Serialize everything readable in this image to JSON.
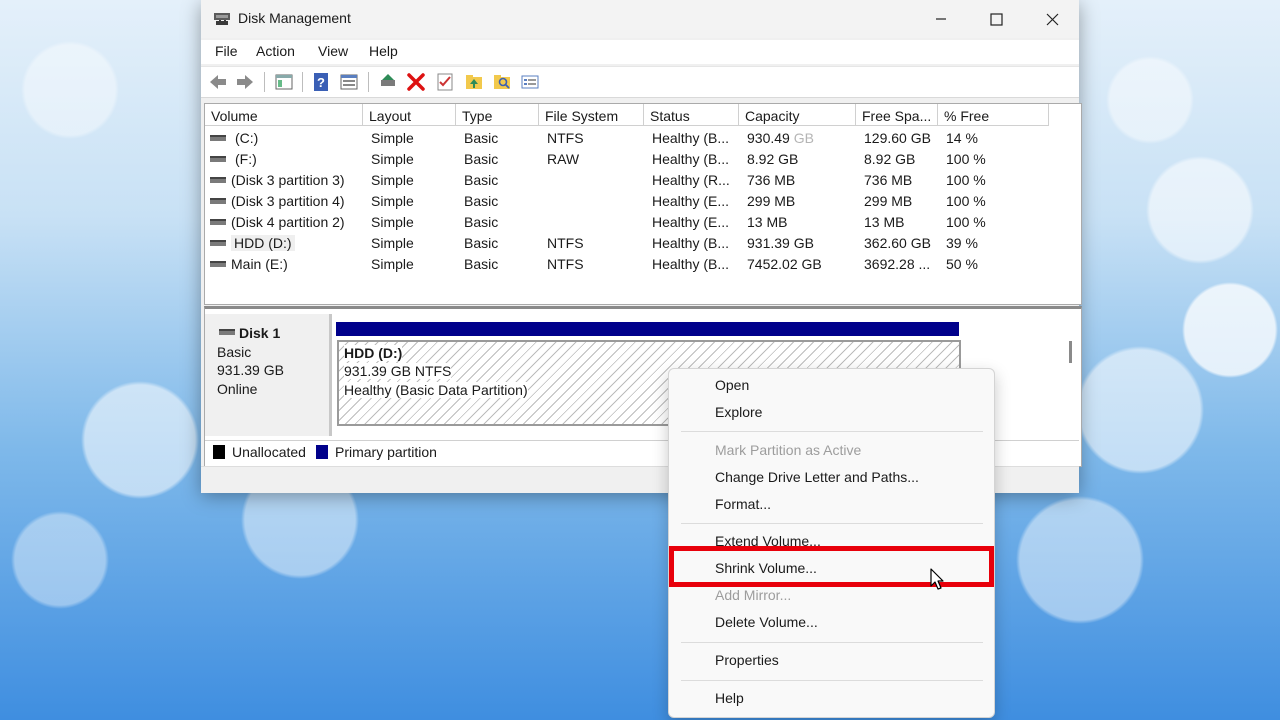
{
  "window": {
    "title": "Disk Management",
    "app_icon": "disk-management-icon",
    "controls": [
      "minimize-icon",
      "maximize-icon",
      "close-icon"
    ]
  },
  "menu": [
    "File",
    "Action",
    "View",
    "Help"
  ],
  "toolbar": {
    "icons": [
      "back-arrow-icon",
      "forward-arrow-icon",
      "console-tree-icon",
      "help-icon",
      "properties-icon",
      "connect-drive-icon",
      "delete-icon",
      "checklist-icon",
      "folder-up-icon",
      "folder-search-icon",
      "settings-list-icon"
    ]
  },
  "volume_list": {
    "columns": [
      "Volume",
      "Layout",
      "Type",
      "File System",
      "Status",
      "Capacity",
      "Free Spa...",
      "% Free"
    ],
    "rows": [
      {
        "volume": "(C:)",
        "layout": "Simple",
        "type": "Basic",
        "fs": "NTFS",
        "status": "Healthy (B...",
        "capacity": "930.49",
        "capacity_unit": "GB",
        "free": "129.60 GB",
        "pct": "14 %"
      },
      {
        "volume": "(F:)",
        "layout": "Simple",
        "type": "Basic",
        "fs": "RAW",
        "status": "Healthy (B...",
        "capacity": "8.92 GB",
        "capacity_unit": "",
        "free": "8.92 GB",
        "pct": "100 %"
      },
      {
        "volume": "(Disk 3 partition 3)",
        "layout": "Simple",
        "type": "Basic",
        "fs": "",
        "status": "Healthy (R...",
        "capacity": "736 MB",
        "capacity_unit": "",
        "free": "736 MB",
        "pct": "100 %"
      },
      {
        "volume": "(Disk 3 partition 4)",
        "layout": "Simple",
        "type": "Basic",
        "fs": "",
        "status": "Healthy (E...",
        "capacity": "299 MB",
        "capacity_unit": "",
        "free": "299 MB",
        "pct": "100 %"
      },
      {
        "volume": "(Disk 4 partition 2)",
        "layout": "Simple",
        "type": "Basic",
        "fs": "",
        "status": "Healthy (E...",
        "capacity": "13 MB",
        "capacity_unit": "",
        "free": "13 MB",
        "pct": "100 %"
      },
      {
        "volume": "HDD (D:)",
        "layout": "Simple",
        "type": "Basic",
        "fs": "NTFS",
        "status": "Healthy (B...",
        "capacity": "931.39 GB",
        "capacity_unit": "",
        "free": "362.60 GB",
        "pct": "39 %"
      },
      {
        "volume": "Main (E:)",
        "layout": "Simple",
        "type": "Basic",
        "fs": "NTFS",
        "status": "Healthy (B...",
        "capacity": "7452.02 GB",
        "capacity_unit": "",
        "free": "3692.28 ...",
        "pct": "50 %"
      }
    ]
  },
  "disk": {
    "name": "Disk 1",
    "type": "Basic",
    "size": "931.39 GB",
    "state": "Online",
    "partition": {
      "label": "HDD  (D:)",
      "size_fs": "931.39 GB NTFS",
      "status": "Healthy (Basic Data Partition)"
    }
  },
  "legend": {
    "unallocated": "Unallocated",
    "primary": "Primary partition",
    "unallocated_color": "#000000",
    "primary_color": "#00008b"
  },
  "context_menu": {
    "items": [
      {
        "label": "Open",
        "enabled": true
      },
      {
        "label": "Explore",
        "enabled": true
      },
      {
        "label": "Mark Partition as Active",
        "enabled": false
      },
      {
        "label": "Change Drive Letter and Paths...",
        "enabled": true
      },
      {
        "label": "Format...",
        "enabled": true
      },
      {
        "label": "Extend Volume...",
        "enabled": true
      },
      {
        "label": "Shrink Volume...",
        "enabled": true,
        "highlighted": true
      },
      {
        "label": "Add Mirror...",
        "enabled": false
      },
      {
        "label": "Delete Volume...",
        "enabled": true
      },
      {
        "label": "Properties",
        "enabled": true
      },
      {
        "label": "Help",
        "enabled": true
      }
    ],
    "highlight_color": "#e8000b"
  }
}
